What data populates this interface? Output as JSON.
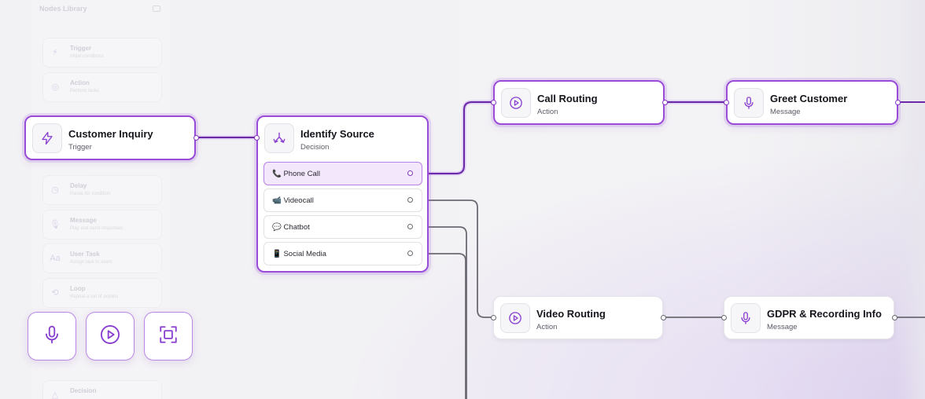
{
  "library": {
    "title": "Nodes Library",
    "items": [
      {
        "name": "Trigger",
        "sub": "Initial conditions",
        "icon": "lightning-icon"
      },
      {
        "name": "Action",
        "sub": "Perform tasks",
        "icon": "play-icon"
      },
      {
        "name": "Delay",
        "sub": "Pause for condition",
        "icon": "clock-icon"
      },
      {
        "name": "Message",
        "sub": "Play and send responses",
        "icon": "microphone-icon"
      },
      {
        "name": "User Task",
        "sub": "Assign task to users",
        "icon": "text-icon"
      },
      {
        "name": "Loop",
        "sub": "Repeat a set of actions",
        "icon": "loop-icon"
      },
      {
        "name": "Decision",
        "sub": "",
        "icon": "decision-icon"
      }
    ]
  },
  "nodes": {
    "customer_inquiry": {
      "title": "Customer Inquiry",
      "subtitle": "Trigger",
      "icon": "lightning-icon"
    },
    "identify_source": {
      "title": "Identify Source",
      "subtitle": "Decision",
      "icon": "split-icon",
      "options": [
        {
          "label": "📞 Phone Call",
          "selected": true
        },
        {
          "label": "📹 Videocall",
          "selected": false
        },
        {
          "label": "💬 Chatbot",
          "selected": false
        },
        {
          "label": "📱 Social Media",
          "selected": false
        }
      ]
    },
    "call_routing": {
      "title": "Call Routing",
      "subtitle": "Action",
      "icon": "play-icon"
    },
    "greet_customer": {
      "title": "Greet Customer",
      "subtitle": "Message",
      "icon": "microphone-icon"
    },
    "video_routing": {
      "title": "Video Routing",
      "subtitle": "Action",
      "icon": "play-icon"
    },
    "gdpr_info": {
      "title": "GDPR & Recording Info",
      "subtitle": "Message",
      "icon": "microphone-icon"
    }
  },
  "tools": [
    {
      "icon": "microphone-icon"
    },
    {
      "icon": "play-icon"
    },
    {
      "icon": "focus-frame-icon"
    }
  ],
  "colors": {
    "accent": "#9a4cd8",
    "active_edge": "#6b2aa8",
    "inactive_edge": "#6b6a72",
    "icon": "#8a3fd0"
  }
}
